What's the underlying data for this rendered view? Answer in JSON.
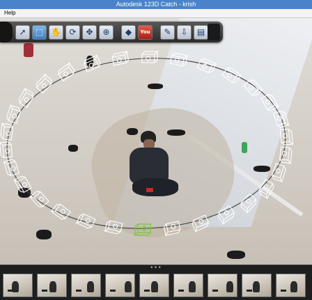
{
  "window": {
    "title": "Autodesk 123D Catch - krish"
  },
  "menu": {
    "items": [
      "Help"
    ]
  },
  "toolbar": {
    "tools": [
      {
        "name": "select-tool-icon",
        "glyph": "➚"
      },
      {
        "name": "select-region-icon",
        "glyph": "⬚",
        "active": true
      },
      {
        "name": "pan-hand-icon",
        "glyph": "✋"
      },
      {
        "name": "orbit-icon",
        "glyph": "⟳"
      },
      {
        "name": "move-icon",
        "glyph": "✥"
      },
      {
        "name": "zoom-icon",
        "glyph": "⊕"
      },
      {
        "name": "mesh-icon",
        "glyph": "◆"
      },
      {
        "name": "youtube-icon",
        "glyph": "You"
      },
      {
        "name": "eyedropper-icon",
        "glyph": "✎"
      },
      {
        "name": "export-icon",
        "glyph": "⇩"
      },
      {
        "name": "notes-icon",
        "glyph": "▤"
      }
    ]
  },
  "filmstrip": {
    "grip": "•••",
    "thumbnail_count": 9
  },
  "colors": {
    "titlebar": "#4a83c9",
    "toolbar": "#3a3a3a",
    "camera_icon": "#ffffff",
    "selected_camera": "#7ec843"
  }
}
